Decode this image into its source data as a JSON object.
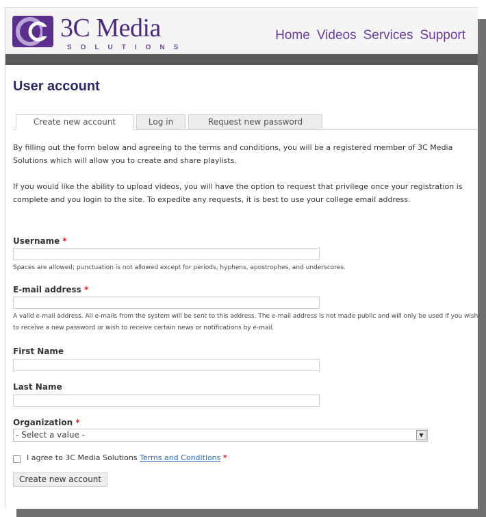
{
  "brand": {
    "name": "3C Media",
    "subtitle": "SOLUTIONS",
    "purple": "#4b2a7e",
    "nav_color": "#6b3b9a"
  },
  "nav": {
    "home": "Home",
    "videos": "Videos",
    "services": "Services",
    "support": "Support"
  },
  "page": {
    "title": "User account"
  },
  "tabs": {
    "create": "Create new account",
    "login": "Log in",
    "request": "Request new password"
  },
  "intro": {
    "p1": "By filling out the form below and agreeing to the terms and conditions, you will be a registered member of 3C Media Solutions which will allow you to create and share playlists.",
    "p2": "If you would like the ability to upload videos, you will have the option to request that privilege once your registration is complete and you login to the site. To expedite any requests, it is best to use your college email address."
  },
  "form": {
    "username_label": "Username",
    "username_desc": "Spaces are allowed; punctuation is not allowed except for periods, hyphens, apostrophes, and underscores.",
    "email_label": "E-mail address",
    "email_desc": "A valid e-mail address. All e-mails from the system will be sent to this address. The e-mail address is not made public and will only be used if you wish to receive a new password or wish to receive certain news or notifications by e-mail.",
    "first_name_label": "First Name",
    "last_name_label": "Last Name",
    "organization_label": "Organization",
    "organization_value": "- Select a value -",
    "required_mark": "*",
    "agree_text": "I agree to 3C Media Solutions ",
    "terms_link": "Terms and Conditions",
    "submit_label": "Create new account"
  }
}
